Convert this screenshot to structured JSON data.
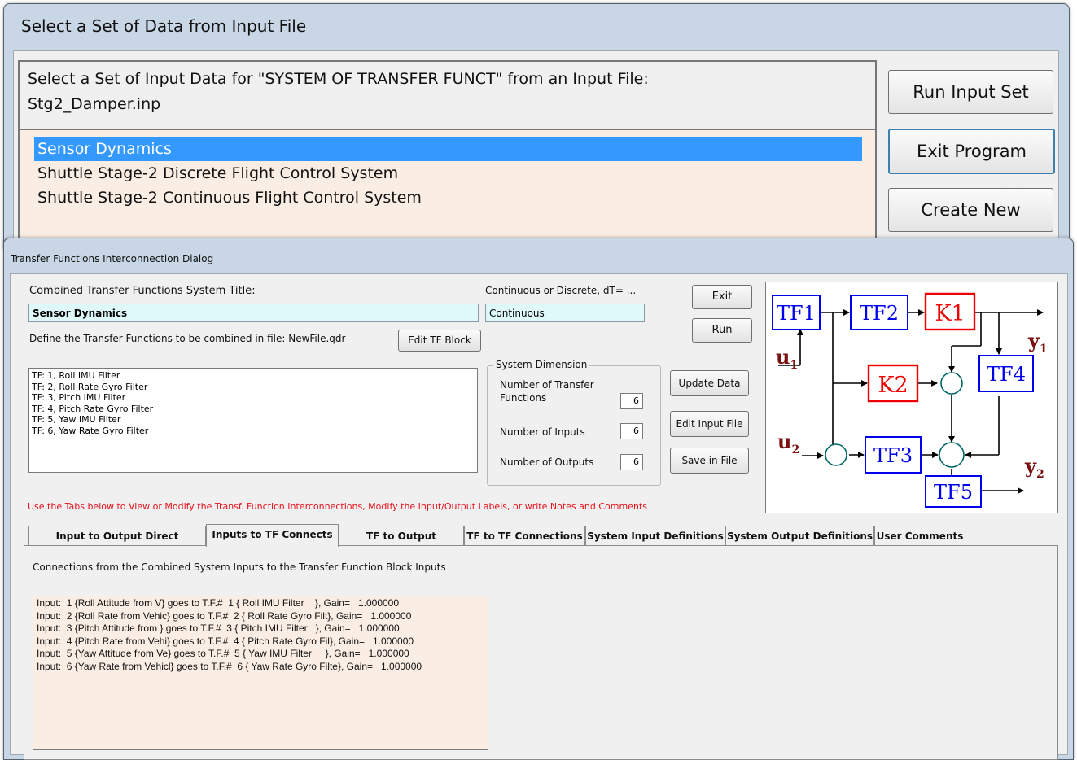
{
  "top_dialog": {
    "title": "Select a Set of Data from Input File",
    "prompt": "Select a Set of Input Data for \"SYSTEM OF TRANSFER FUNCT\" from an Input File:",
    "file_name": "Stg2_Damper.inp",
    "items": [
      "Sensor Dynamics",
      "Shuttle Stage-2 Discrete Flight Control System",
      "Shuttle Stage-2 Continuous Flight Control System"
    ],
    "selected_index": 0,
    "buttons": {
      "run": "Run Input Set",
      "exit": "Exit Program",
      "create": "Create New"
    }
  },
  "bottom_dialog": {
    "title": "Transfer Functions Interconnection Dialog",
    "system_title_label": "Combined Transfer Functions System Title:",
    "system_title_value": "Sensor Dynamics",
    "mode_label": "Continuous or Discrete, dT= ...",
    "mode_value": "Continuous",
    "define_label": "Define the Transfer Functions to be combined in file: NewFile.qdr",
    "buttons": {
      "edit_tf_block": "Edit TF Block",
      "exit": "Exit",
      "run": "Run",
      "update_data": "Update Data",
      "edit_input_file": "Edit Input File",
      "save_in_file": "Save in File"
    },
    "tf_list": [
      "TF:  1, Roll IMU Filter",
      "TF:  2, Roll Rate Gyro Filter",
      "TF:  3, Pitch IMU Filter",
      "TF:  4, Pitch Rate Gyro Filter",
      "TF:  5, Yaw IMU Filter",
      "TF:  6, Yaw Rate Gyro Filter"
    ],
    "system_dimension": {
      "group_label": "System Dimension",
      "num_tf_label": "Number of Transfer Functions",
      "num_tf": "6",
      "num_inputs_label": "Number of Inputs",
      "num_inputs": "6",
      "num_outputs_label": "Number of Outputs",
      "num_outputs": "6"
    },
    "hint": "Use the Tabs below to View or Modify the Transf. Function Interconnections, Modify the Input/Output Labels, or write Notes and Comments",
    "tabs": [
      "Input to Output Direct Connects",
      "Inputs to TF Connects",
      "TF to Output Connects",
      "TF to TF Connections",
      "System Input Definitions",
      "System Output Definitions",
      "User Comments"
    ],
    "active_tab": 1,
    "panel_heading": "Connections from the Combined System Inputs to the Transfer Function Block Inputs",
    "connections": [
      "Input:  1 {Roll Attitude from V} goes to T.F.#  1 { Roll IMU Filter    }, Gain=   1.000000",
      "Input:  2 {Roll Rate from Vehic} goes to T.F.#  2 { Roll Rate Gyro Filt}, Gain=   1.000000",
      "Input:  3 {Pitch Attitude from } goes to T.F.#  3 { Pitch IMU Filter   }, Gain=   1.000000",
      "Input:  4 {Pitch Rate from Vehi} goes to T.F.#  4 { Pitch Rate Gyro Fil}, Gain=   1.000000",
      "Input:  5 {Yaw Attitude from Ve} goes to T.F.#  5 { Yaw IMU Filter     }, Gain=   1.000000",
      "Input:  6 {Yaw Rate from Vehicl} goes to T.F.#  6 { Yaw Rate Gyro Filte}, Gain=   1.000000"
    ],
    "diagram": {
      "blocks": [
        "TF1",
        "TF2",
        "K1",
        "K2",
        "TF4",
        "TF3",
        "TF5"
      ],
      "inputs": [
        "u",
        "1",
        "u",
        "2"
      ],
      "outputs": [
        "y",
        "1",
        "y",
        "2"
      ],
      "colors": {
        "tf": "#0000ee",
        "gain": "#ee0000",
        "signal": "#7a1010",
        "node": "#006666"
      }
    }
  }
}
